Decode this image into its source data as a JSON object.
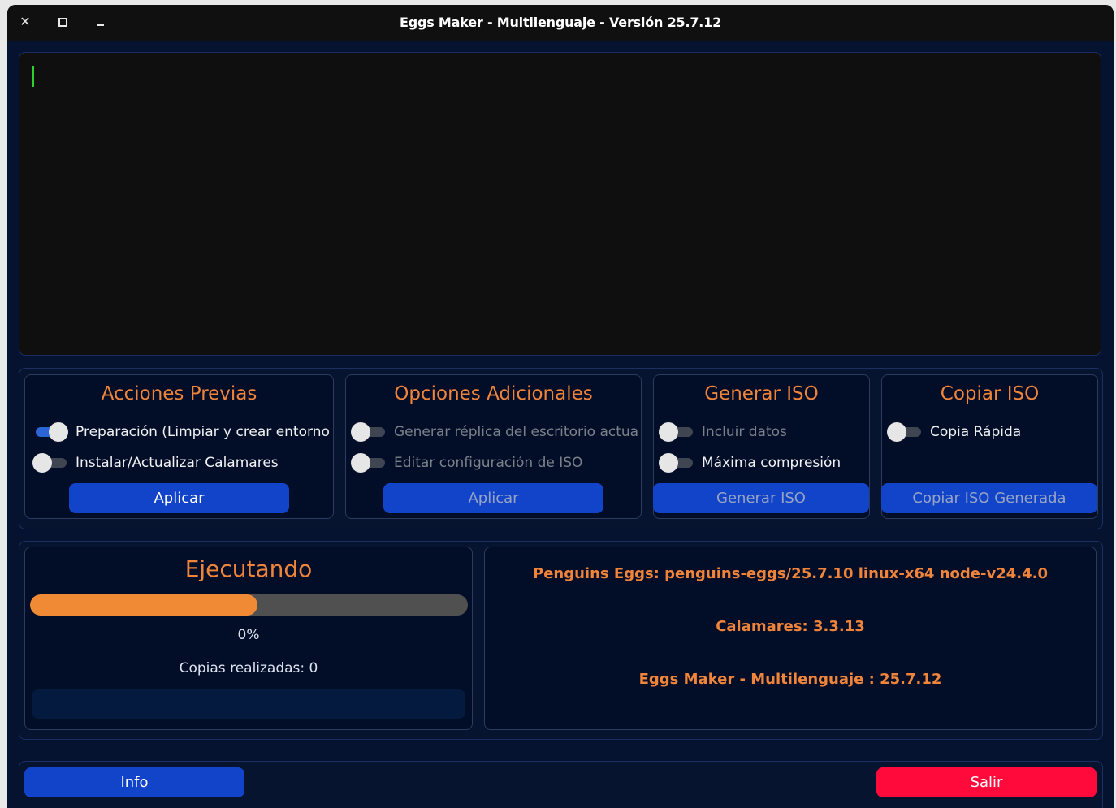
{
  "window": {
    "title": "Eggs Maker - Multilenguaje  - Versión 25.7.12",
    "controls": {
      "close": "✕"
    }
  },
  "terminal": {
    "text": ""
  },
  "sections": {
    "acciones_previas": {
      "title": "Acciones Previas",
      "options": [
        {
          "label": "Preparación (Limpiar y crear entorno",
          "on": true,
          "enabled": true
        },
        {
          "label": "Instalar/Actualizar Calamares",
          "on": false,
          "enabled": true
        }
      ],
      "button": "Aplicar"
    },
    "opciones_adicionales": {
      "title": "Opciones Adicionales",
      "options": [
        {
          "label": "Generar réplica del escritorio actua",
          "on": false,
          "enabled": false
        },
        {
          "label": "Editar configuración de ISO",
          "on": false,
          "enabled": false
        }
      ],
      "button": "Aplicar"
    },
    "generar_iso": {
      "title": "Generar ISO",
      "options": [
        {
          "label": "Incluir datos",
          "on": false,
          "enabled": false
        },
        {
          "label": "Máxima compresión",
          "on": false,
          "enabled": true
        }
      ],
      "button": "Generar ISO"
    },
    "copiar_iso": {
      "title": "Copiar ISO",
      "options": [
        {
          "label": "Copia Rápida",
          "on": false,
          "enabled": true
        }
      ],
      "button": "Copiar ISO Generada"
    }
  },
  "status": {
    "title": "Ejecutando",
    "progress_fill_fraction": 0.52,
    "percent_text": "0%",
    "copies_text": "Copias realizadas: 0"
  },
  "info": {
    "penguins": "Penguins Eggs: penguins-eggs/25.7.10 linux-x64 node-v24.4.0",
    "calamares": "Calamares: 3.3.13",
    "eggs_maker": "Eggs Maker - Multilenguaje : 25.7.12"
  },
  "footer": {
    "info_button": "Info",
    "exit_button": "Salir"
  },
  "colors": {
    "accent_orange": "#f0843a",
    "button_blue": "#1244c9",
    "button_red": "#ff0a3a",
    "terminal_cursor": "#2fd12f"
  }
}
